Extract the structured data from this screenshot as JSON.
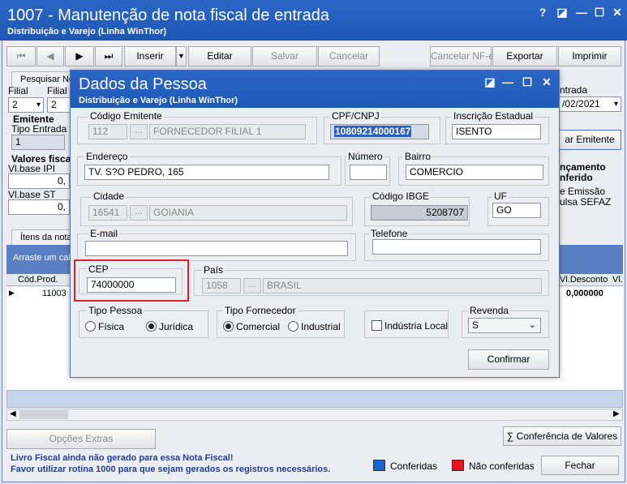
{
  "window": {
    "title": "1007 - Manutenção de nota fiscal de entrada",
    "subtitle": "Distribuição e Varejo (Linha WinThor)",
    "help_glyph": "?",
    "restore_glyph": "◪",
    "minimize_glyph": "—",
    "maximize_glyph": "☐",
    "close_glyph": "✕"
  },
  "toolbar": {
    "first": "⏮",
    "prev": "◀",
    "next": "▶",
    "last": "⏭",
    "inserir": "Inserir",
    "editar": "Editar",
    "salvar": "Salvar",
    "cancelar": "Cancelar",
    "cancelar_nfe": "Cancelar NF-e",
    "exportar": "Exportar",
    "imprimir": "Imprimir"
  },
  "background": {
    "tab_pesquisar": "Pesquisar No",
    "filial_label": "Filial",
    "filial_nf_label": "Filial Nf",
    "filial_value": "2",
    "filial_nf_value": "2",
    "emitente_label": "Emitente",
    "tipo_entrada_label": "Tipo Entrada",
    "tipo_entrada_value": "1",
    "valores_fiscais_label": "Valores fisca",
    "vl_base_ipi_label": "Vl.base IPI",
    "vl_base_ipi_value": "0,",
    "vl_base_st_label": "Vl.base ST",
    "vl_base_st_value": "0,",
    "entrada_label": "ntrada",
    "entrada_date": "/02/2021",
    "mudar_emitente": "ar Emitente",
    "lancamento_1": "nçamento",
    "lancamento_2": "nferido",
    "emissao": "e Emissão",
    "sefaz": "ulsa SEFAZ",
    "itens_tab": "Ítens da nota",
    "drag_hint": "Arraste um cab",
    "col_cod_prod": "Cód.Prod.",
    "col_vl_desconto": "Vl.Desconto",
    "col_vl": "Vl.",
    "row_cod": "11003",
    "row_desconto": "0,000000",
    "opcoes_extras": "Opções Extras",
    "conferencia_valores": "Conferência de Valores",
    "livro_fiscal_msg": "Livro Fiscal ainda não gerado para essa Nota Fiscal!",
    "rotina_msg": "Favor utilizar rotina 1000 para que sejam gerados os registros necessários.",
    "legend_conferidas": "Conferidas",
    "legend_nao_conferidas": "Não conferidas",
    "fechar": "Fechar",
    "color_conferidas": "#1565d8",
    "color_nao_conferidas": "#e8141c"
  },
  "dialog": {
    "title": "Dados da Pessoa",
    "subtitle": "Distribuição e Varejo (Linha WinThor)",
    "codigo_emitente_label": "Código Emitente",
    "codigo_emitente_value": "112",
    "emitente_nome": "FORNECEDOR FILIAL 1",
    "cpf_cnpj_label": "CPF/CNPJ",
    "cpf_cnpj_value": "10809214000167",
    "inscricao_label": "Inscrição Estadual",
    "inscricao_value": "ISENTO",
    "endereco_label": "Endereço",
    "endereco_value": "TV. S?O PEDRO, 165",
    "numero_label": "Número",
    "numero_value": "",
    "bairro_label": "Bairro",
    "bairro_value": "COMERCIO",
    "cidade_label": "Cidade",
    "cidade_code": "16541",
    "cidade_nome": "GOIANIA",
    "ibge_label": "Código IBGE",
    "ibge_value": "5208707",
    "uf_label": "UF",
    "uf_value": "GO",
    "email_label": "E-mail",
    "email_value": "",
    "telefone_label": "Telefone",
    "telefone_value": "",
    "cep_label": "CEP",
    "cep_value": "74000000",
    "pais_label": "País",
    "pais_code": "1058",
    "pais_nome": "BRASIL",
    "tipo_pessoa_label": "Tipo Pessoa",
    "fisica": "Física",
    "juridica": "Jurídica",
    "tipo_fornecedor_label": "Tipo Fornecedor",
    "comercial": "Comercial",
    "industrial": "Industrial",
    "industria_local": "Indústria Local",
    "revenda_label": "Revenda",
    "revenda_value": "S",
    "confirmar": "Confirmar",
    "lookup_glyph": "...",
    "highlight_color": "#e0202a"
  }
}
